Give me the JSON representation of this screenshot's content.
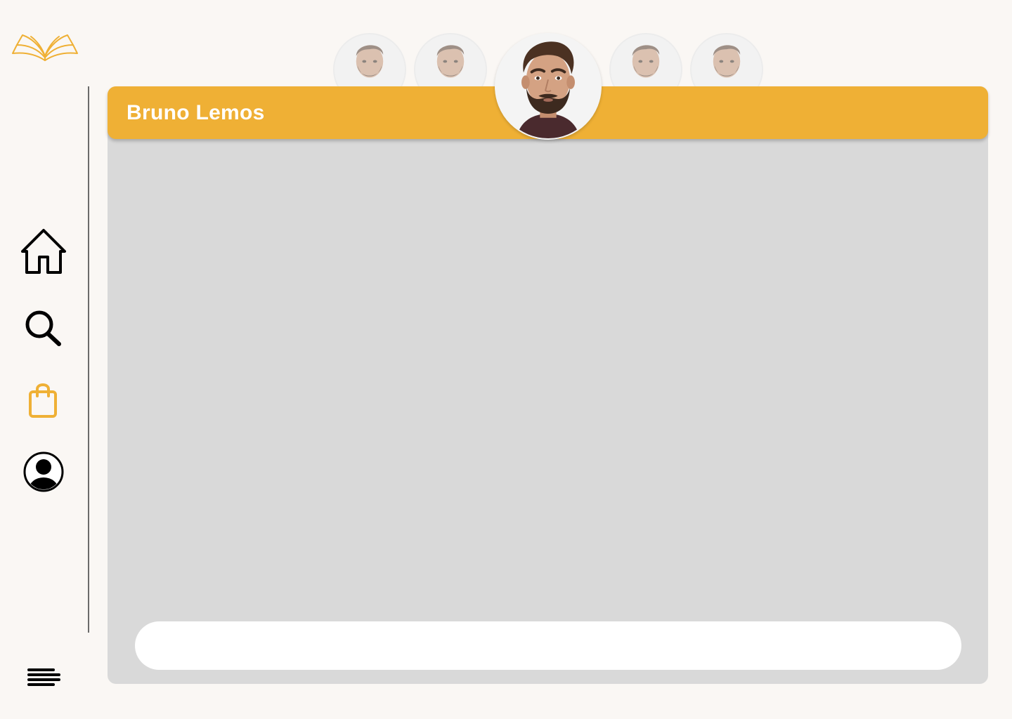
{
  "app": {
    "logo_icon": "open-book-icon",
    "accent_color": "#efb035",
    "background_color": "#faf7f4"
  },
  "sidebar": {
    "items": [
      {
        "icon": "home-icon",
        "active": false
      },
      {
        "icon": "search-icon",
        "active": false
      },
      {
        "icon": "shopping-bag-icon",
        "active": true
      },
      {
        "icon": "user-circle-icon",
        "active": false
      }
    ],
    "menu_icon": "menu-icon"
  },
  "chat": {
    "contact_name": "Bruno Lemos",
    "header_color": "#efb035",
    "message_input": {
      "value": "",
      "placeholder": ""
    }
  },
  "contacts": {
    "avatars": [
      {
        "selected": false
      },
      {
        "selected": false
      },
      {
        "selected": true
      },
      {
        "selected": false
      },
      {
        "selected": false
      }
    ]
  }
}
